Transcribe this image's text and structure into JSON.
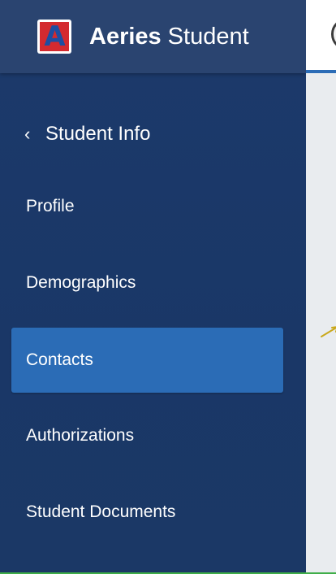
{
  "app": {
    "logo_letter": "A",
    "brand_bold": "Aeries",
    "brand_regular": "Student"
  },
  "sidebar": {
    "back_label": "Student Info",
    "items": [
      {
        "label": "Profile",
        "active": false
      },
      {
        "label": "Demographics",
        "active": false
      },
      {
        "label": "Contacts",
        "active": true
      },
      {
        "label": "Authorizations",
        "active": false
      },
      {
        "label": "Student Documents",
        "active": false
      }
    ]
  },
  "icons": {
    "back": "chevron-left-icon",
    "avatar": "user-avatar-icon"
  },
  "colors": {
    "sidebar_bg": "#1c3a6b",
    "header_bg": "#2a4470",
    "active_item_bg": "#2b6cb6",
    "logo_red": "#d42a2f",
    "logo_blue": "#1d4ea2",
    "content_bg": "#e9ecef"
  }
}
